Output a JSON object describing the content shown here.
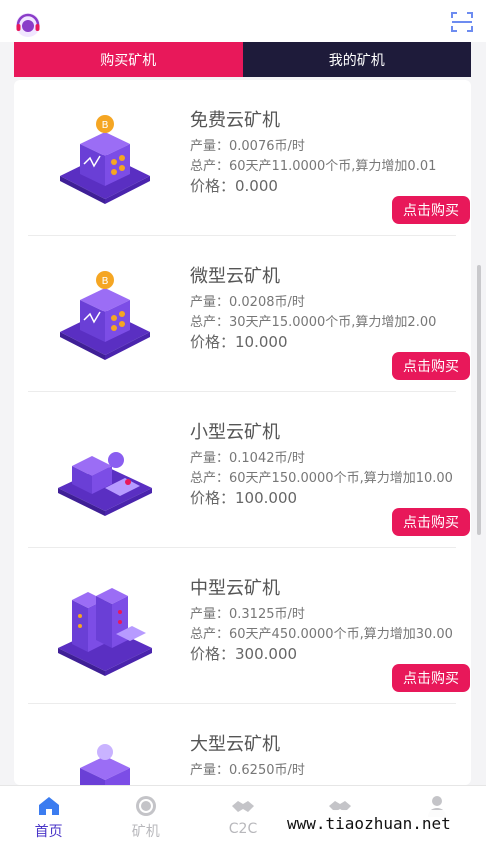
{
  "header": {
    "avatar_icon": "headset-avatar-icon",
    "scan_icon": "scan-icon"
  },
  "tabs": [
    {
      "label": "购买矿机",
      "active": true
    },
    {
      "label": "我的矿机",
      "active": false
    }
  ],
  "miners": [
    {
      "name": "免费云矿机",
      "output": "产量：0.0076币/时",
      "total": "总产：60天产11.0000个币,算力增加0.01",
      "price": "价格：0.000",
      "button": "点击购买"
    },
    {
      "name": "微型云矿机",
      "output": "产量：0.0208币/时",
      "total": "总产：30天产15.0000个币,算力增加2.00",
      "price": "价格：10.000",
      "button": "点击购买"
    },
    {
      "name": "小型云矿机",
      "output": "产量：0.1042币/时",
      "total": "总产：60天产150.0000个币,算力增加10.00",
      "price": "价格：100.000",
      "button": "点击购买"
    },
    {
      "name": "中型云矿机",
      "output": "产量：0.3125币/时",
      "total": "总产：60天产450.0000个币,算力增加30.00",
      "price": "价格：300.000",
      "button": "点击购买"
    },
    {
      "name": "大型云矿机",
      "output": "产量：0.6250币/时",
      "total": "",
      "price": "",
      "button": ""
    }
  ],
  "nav": [
    {
      "label": "首页",
      "icon": "home-icon",
      "active": true
    },
    {
      "label": "矿机",
      "icon": "coin-icon",
      "active": false
    },
    {
      "label": "C2C",
      "icon": "handshake-icon",
      "active": false
    },
    {
      "label": "",
      "icon": "handshake-icon",
      "active": false
    },
    {
      "label": "",
      "icon": "user-icon",
      "active": false
    }
  ],
  "watermark": "www.tiaozhuan.net",
  "colors": {
    "accent": "#e8185a",
    "dark_tab": "#1e1b3a",
    "nav_active": "#4a36c8",
    "miner_purple": "#6a3fd6"
  }
}
